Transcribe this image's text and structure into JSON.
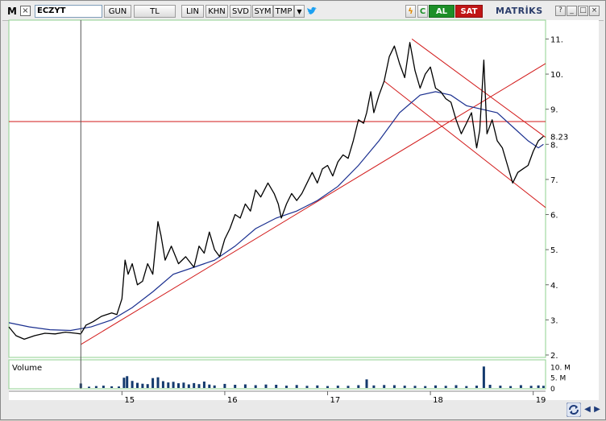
{
  "toolbar": {
    "logo": "M",
    "close_glyph": "×",
    "symbol": "ECZYT",
    "buttons": [
      "GUN",
      "TL",
      "LIN",
      "KHN",
      "SVD",
      "SYM",
      "TMP"
    ],
    "dropdown_glyph": "▼",
    "twitter_icon": "twitter-icon",
    "lightning_glyph": "ϟ",
    "c_label": "C",
    "buy_label": "AL",
    "sell_label": "SAT",
    "brand": "MATRİKS",
    "win_buttons": [
      "?",
      "_",
      "□",
      "×"
    ]
  },
  "colors": {
    "price": "#000000",
    "ma": "#1a2f8f",
    "trend": "#d21a1a",
    "volume": "#143a6e",
    "grid_border": "#8fd18f",
    "buy": "#1d8f28",
    "sell": "#c01616"
  },
  "chart_data": {
    "type": "line",
    "ylim": [
      2,
      11.4
    ],
    "y_ticks": [
      "11.",
      "10.",
      "9.",
      "8.",
      "7.",
      "6.",
      "5.",
      "4.",
      "3.",
      "2."
    ],
    "y_tick_values": [
      11,
      10,
      9,
      8,
      7,
      6,
      5,
      4,
      3,
      2
    ],
    "x_ticks": [
      "15",
      "16",
      "17",
      "18",
      "19"
    ],
    "x_tick_values": [
      2015,
      2016,
      2017,
      2018,
      2019
    ],
    "xlim": [
      2013.9,
      2019.12
    ],
    "last_price_label": "8.23",
    "last_price": 8.23,
    "horizontal_level": 8.65,
    "volume_label": "Volume",
    "volume_ticks": [
      "10. M",
      "5. M",
      "0"
    ],
    "volume_tick_values": [
      10,
      5,
      0
    ],
    "volume_max": 12,
    "price_series": [
      [
        2013.9,
        2.8
      ],
      [
        2013.97,
        2.55
      ],
      [
        2014.05,
        2.45
      ],
      [
        2014.15,
        2.55
      ],
      [
        2014.25,
        2.62
      ],
      [
        2014.35,
        2.6
      ],
      [
        2014.45,
        2.65
      ],
      [
        2014.55,
        2.62
      ],
      [
        2014.6,
        2.6
      ],
      [
        2014.65,
        2.85
      ],
      [
        2014.72,
        2.95
      ],
      [
        2014.8,
        3.1
      ],
      [
        2014.9,
        3.2
      ],
      [
        2014.95,
        3.15
      ],
      [
        2015.0,
        3.6
      ],
      [
        2015.03,
        4.7
      ],
      [
        2015.06,
        4.3
      ],
      [
        2015.1,
        4.6
      ],
      [
        2015.15,
        4.0
      ],
      [
        2015.2,
        4.1
      ],
      [
        2015.25,
        4.6
      ],
      [
        2015.3,
        4.3
      ],
      [
        2015.35,
        5.8
      ],
      [
        2015.38,
        5.4
      ],
      [
        2015.42,
        4.7
      ],
      [
        2015.48,
        5.1
      ],
      [
        2015.55,
        4.6
      ],
      [
        2015.62,
        4.8
      ],
      [
        2015.7,
        4.5
      ],
      [
        2015.75,
        5.1
      ],
      [
        2015.8,
        4.9
      ],
      [
        2015.85,
        5.5
      ],
      [
        2015.9,
        5.0
      ],
      [
        2015.95,
        4.8
      ],
      [
        2016.0,
        5.3
      ],
      [
        2016.05,
        5.6
      ],
      [
        2016.1,
        6.0
      ],
      [
        2016.15,
        5.9
      ],
      [
        2016.2,
        6.3
      ],
      [
        2016.25,
        6.1
      ],
      [
        2016.3,
        6.7
      ],
      [
        2016.35,
        6.5
      ],
      [
        2016.42,
        6.9
      ],
      [
        2016.48,
        6.6
      ],
      [
        2016.52,
        6.3
      ],
      [
        2016.55,
        5.9
      ],
      [
        2016.6,
        6.3
      ],
      [
        2016.65,
        6.6
      ],
      [
        2016.7,
        6.4
      ],
      [
        2016.75,
        6.6
      ],
      [
        2016.8,
        6.9
      ],
      [
        2016.85,
        7.2
      ],
      [
        2016.9,
        6.9
      ],
      [
        2016.95,
        7.3
      ],
      [
        2017.0,
        7.4
      ],
      [
        2017.05,
        7.1
      ],
      [
        2017.1,
        7.5
      ],
      [
        2017.15,
        7.7
      ],
      [
        2017.2,
        7.6
      ],
      [
        2017.25,
        8.1
      ],
      [
        2017.3,
        8.7
      ],
      [
        2017.35,
        8.6
      ],
      [
        2017.38,
        8.9
      ],
      [
        2017.42,
        9.5
      ],
      [
        2017.45,
        8.9
      ],
      [
        2017.5,
        9.4
      ],
      [
        2017.55,
        9.8
      ],
      [
        2017.6,
        10.5
      ],
      [
        2017.65,
        10.8
      ],
      [
        2017.7,
        10.3
      ],
      [
        2017.75,
        9.9
      ],
      [
        2017.8,
        10.9
      ],
      [
        2017.85,
        10.1
      ],
      [
        2017.9,
        9.6
      ],
      [
        2017.95,
        10.0
      ],
      [
        2018.0,
        10.2
      ],
      [
        2018.05,
        9.6
      ],
      [
        2018.1,
        9.5
      ],
      [
        2018.15,
        9.3
      ],
      [
        2018.2,
        9.2
      ],
      [
        2018.25,
        8.7
      ],
      [
        2018.3,
        8.3
      ],
      [
        2018.35,
        8.6
      ],
      [
        2018.4,
        8.9
      ],
      [
        2018.45,
        7.9
      ],
      [
        2018.48,
        8.4
      ],
      [
        2018.52,
        10.4
      ],
      [
        2018.55,
        8.3
      ],
      [
        2018.6,
        8.7
      ],
      [
        2018.65,
        8.1
      ],
      [
        2018.7,
        7.9
      ],
      [
        2018.75,
        7.4
      ],
      [
        2018.8,
        6.9
      ],
      [
        2018.85,
        7.2
      ],
      [
        2018.9,
        7.3
      ],
      [
        2018.95,
        7.4
      ],
      [
        2019.0,
        7.8
      ],
      [
        2019.05,
        8.1
      ],
      [
        2019.1,
        8.23
      ]
    ],
    "ma_series": [
      [
        2013.9,
        2.92
      ],
      [
        2014.1,
        2.8
      ],
      [
        2014.3,
        2.72
      ],
      [
        2014.5,
        2.7
      ],
      [
        2014.7,
        2.8
      ],
      [
        2014.9,
        3.0
      ],
      [
        2015.1,
        3.35
      ],
      [
        2015.3,
        3.8
      ],
      [
        2015.5,
        4.3
      ],
      [
        2015.7,
        4.5
      ],
      [
        2015.9,
        4.7
      ],
      [
        2016.1,
        5.1
      ],
      [
        2016.3,
        5.6
      ],
      [
        2016.5,
        5.9
      ],
      [
        2016.7,
        6.1
      ],
      [
        2016.9,
        6.4
      ],
      [
        2017.1,
        6.8
      ],
      [
        2017.3,
        7.4
      ],
      [
        2017.5,
        8.1
      ],
      [
        2017.7,
        8.9
      ],
      [
        2017.9,
        9.4
      ],
      [
        2018.05,
        9.5
      ],
      [
        2018.2,
        9.4
      ],
      [
        2018.35,
        9.1
      ],
      [
        2018.5,
        9.0
      ],
      [
        2018.65,
        8.9
      ],
      [
        2018.8,
        8.5
      ],
      [
        2018.95,
        8.1
      ],
      [
        2019.05,
        7.9
      ],
      [
        2019.1,
        8.0
      ]
    ],
    "trend_lines": [
      [
        [
          2014.6,
          2.3
        ],
        [
          2019.12,
          10.3
        ]
      ],
      [
        [
          2017.82,
          11.0
        ],
        [
          2019.12,
          8.2
        ]
      ],
      [
        [
          2017.55,
          9.8
        ],
        [
          2019.12,
          6.2
        ]
      ]
    ],
    "volume": [
      [
        2014.6,
        2.1
      ],
      [
        2014.68,
        0.6
      ],
      [
        2014.75,
        0.9
      ],
      [
        2014.82,
        1.1
      ],
      [
        2014.9,
        0.8
      ],
      [
        2014.97,
        0.7
      ],
      [
        2015.02,
        4.8
      ],
      [
        2015.05,
        5.5
      ],
      [
        2015.1,
        3.3
      ],
      [
        2015.15,
        2.4
      ],
      [
        2015.2,
        2.0
      ],
      [
        2015.25,
        1.8
      ],
      [
        2015.3,
        4.6
      ],
      [
        2015.35,
        5.0
      ],
      [
        2015.4,
        3.2
      ],
      [
        2015.45,
        2.6
      ],
      [
        2015.5,
        2.9
      ],
      [
        2015.55,
        2.2
      ],
      [
        2015.6,
        2.5
      ],
      [
        2015.65,
        1.7
      ],
      [
        2015.7,
        2.3
      ],
      [
        2015.75,
        1.8
      ],
      [
        2015.8,
        3.0
      ],
      [
        2015.85,
        1.6
      ],
      [
        2015.9,
        1.2
      ],
      [
        2016.0,
        1.9
      ],
      [
        2016.1,
        1.5
      ],
      [
        2016.2,
        1.7
      ],
      [
        2016.3,
        1.3
      ],
      [
        2016.4,
        1.6
      ],
      [
        2016.5,
        1.5
      ],
      [
        2016.6,
        1.1
      ],
      [
        2016.7,
        1.4
      ],
      [
        2016.8,
        1.0
      ],
      [
        2016.9,
        1.2
      ],
      [
        2017.0,
        0.9
      ],
      [
        2017.1,
        1.1
      ],
      [
        2017.2,
        1.0
      ],
      [
        2017.3,
        1.3
      ],
      [
        2017.38,
        4.0
      ],
      [
        2017.45,
        1.2
      ],
      [
        2017.55,
        1.4
      ],
      [
        2017.65,
        1.3
      ],
      [
        2017.75,
        1.1
      ],
      [
        2017.85,
        1.0
      ],
      [
        2017.95,
        0.9
      ],
      [
        2018.05,
        1.2
      ],
      [
        2018.15,
        1.0
      ],
      [
        2018.25,
        1.3
      ],
      [
        2018.35,
        0.9
      ],
      [
        2018.45,
        1.1
      ],
      [
        2018.52,
        10.0
      ],
      [
        2018.58,
        1.5
      ],
      [
        2018.68,
        1.1
      ],
      [
        2018.78,
        0.9
      ],
      [
        2018.88,
        1.3
      ],
      [
        2018.98,
        1.0
      ],
      [
        2019.05,
        1.2
      ],
      [
        2019.1,
        1.0
      ]
    ],
    "crosshair_x": 2014.6
  },
  "footer": {
    "refresh_icon": "refresh-icon",
    "left_arrow": "◀",
    "right_arrow": "▶"
  }
}
